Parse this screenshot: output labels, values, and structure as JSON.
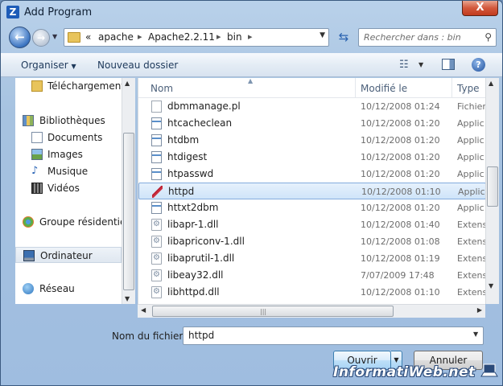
{
  "window": {
    "title": "Add Program",
    "close_label": "X"
  },
  "address": {
    "prefix": "«",
    "segments": [
      "apache",
      "Apache2.2.11",
      "bin"
    ]
  },
  "search": {
    "placeholder": "Rechercher dans : bin"
  },
  "toolbar": {
    "organize": "Organiser",
    "new_folder": "Nouveau dossier",
    "help": "?"
  },
  "nav": {
    "downloads": "Téléchargements",
    "libraries": "Bibliothèques",
    "documents": "Documents",
    "images": "Images",
    "music": "Musique",
    "videos": "Vidéos",
    "homegroup": "Groupe résidentiel",
    "computer": "Ordinateur",
    "network": "Réseau"
  },
  "columns": {
    "name": "Nom",
    "modified": "Modifié le",
    "type": "Type"
  },
  "files": [
    {
      "name": "dbmmanage.pl",
      "date": "10/12/2008 01:24",
      "type": "Fichier"
    },
    {
      "name": "htcacheclean",
      "date": "10/12/2008 01:20",
      "type": "Applic"
    },
    {
      "name": "htdbm",
      "date": "10/12/2008 01:20",
      "type": "Applic"
    },
    {
      "name": "htdigest",
      "date": "10/12/2008 01:20",
      "type": "Applic"
    },
    {
      "name": "htpasswd",
      "date": "10/12/2008 01:20",
      "type": "Applic"
    },
    {
      "name": "httpd",
      "date": "10/12/2008 01:10",
      "type": "Applic"
    },
    {
      "name": "httxt2dbm",
      "date": "10/12/2008 01:20",
      "type": "Applic"
    },
    {
      "name": "libapr-1.dll",
      "date": "10/12/2008 01:40",
      "type": "Extens"
    },
    {
      "name": "libapriconv-1.dll",
      "date": "10/12/2008 01:08",
      "type": "Extens"
    },
    {
      "name": "libaprutil-1.dll",
      "date": "10/12/2008 01:19",
      "type": "Extens"
    },
    {
      "name": "libeay32.dll",
      "date": "7/07/2009 17:48",
      "type": "Extens"
    },
    {
      "name": "libhttpd.dll",
      "date": "10/12/2008 01:10",
      "type": "Extens"
    }
  ],
  "filename": {
    "label": "Nom du fichier :",
    "value": "httpd"
  },
  "buttons": {
    "open": "Ouvrir",
    "cancel": "Annuler"
  },
  "watermark": "InformatiWeb.net"
}
